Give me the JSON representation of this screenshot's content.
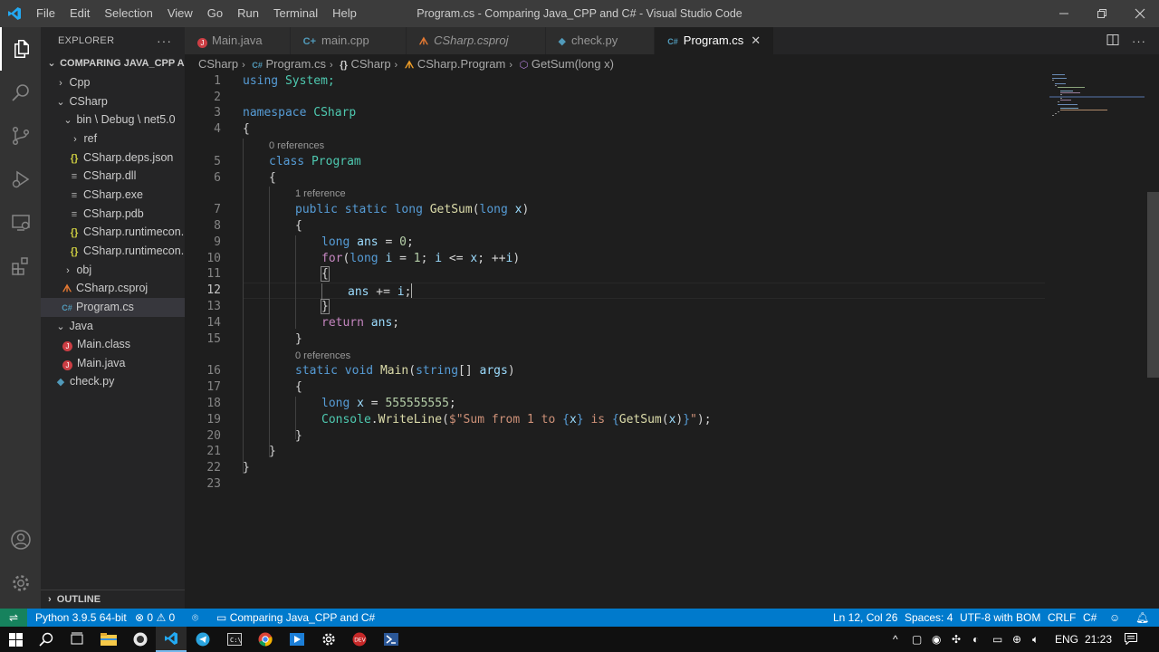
{
  "window": {
    "title": "Program.cs - Comparing Java_CPP and C# - Visual Studio Code",
    "menu": [
      "File",
      "Edit",
      "Selection",
      "View",
      "Go",
      "Run",
      "Terminal",
      "Help"
    ]
  },
  "explorer": {
    "header": "EXPLORER",
    "more": "···",
    "root": "COMPARING JAVA_CPP A...",
    "items": [
      {
        "label": "Cpp",
        "icon": "chevron-right"
      },
      {
        "label": "CSharp",
        "icon": "chevron-down"
      },
      {
        "label": "bin \\ Debug \\ net5.0",
        "icon": "chevron-down"
      },
      {
        "label": "ref",
        "icon": "chevron-right"
      },
      {
        "label": "CSharp.deps.json",
        "icon": "json-icon",
        "glyph": "{}"
      },
      {
        "label": "CSharp.dll",
        "icon": "lines-icon",
        "glyph": "≡"
      },
      {
        "label": "CSharp.exe",
        "icon": "lines-icon",
        "glyph": "≡"
      },
      {
        "label": "CSharp.pdb",
        "icon": "lines-icon",
        "glyph": "≡"
      },
      {
        "label": "CSharp.runtimecon...",
        "icon": "json-icon",
        "glyph": "{}"
      },
      {
        "label": "CSharp.runtimecon...",
        "icon": "json-icon",
        "glyph": "{}"
      },
      {
        "label": "obj",
        "icon": "chevron-right"
      },
      {
        "label": "CSharp.csproj",
        "icon": "rss-icon",
        "glyph": "ᗑ"
      },
      {
        "label": "Program.cs",
        "icon": "csharp-icon",
        "glyph": "C#"
      },
      {
        "label": "Java",
        "icon": "chevron-down"
      },
      {
        "label": "Main.class",
        "icon": "java-icon"
      },
      {
        "label": "Main.java",
        "icon": "java-icon"
      },
      {
        "label": "check.py",
        "icon": "python-icon"
      }
    ],
    "outline": "OUTLINE"
  },
  "tabs": [
    {
      "label": "Main.java",
      "icon": "java-icon"
    },
    {
      "label": "main.cpp",
      "icon": "cpp-icon",
      "glyph": "C+"
    },
    {
      "label": "CSharp.csproj",
      "icon": "rss-icon",
      "glyph": "ᗑ"
    },
    {
      "label": "check.py",
      "icon": "python-icon",
      "glyph": "◆"
    },
    {
      "label": "Program.cs",
      "icon": "csharp-icon",
      "glyph": "C#",
      "close": "✕"
    }
  ],
  "breadcrumb": {
    "parts": [
      "CSharp",
      "Program.cs",
      "CSharp",
      "CSharp.Program",
      "GetSum(long x)"
    ],
    "glyphs": [
      "C#",
      "{}",
      "ᗑ",
      "⬡"
    ]
  },
  "editor": {
    "line_numbers": [
      "1",
      "2",
      "3",
      "4",
      "5",
      "6",
      "7",
      "8",
      "9",
      "10",
      "11",
      "12",
      "13",
      "14",
      "15",
      "16",
      "17",
      "18",
      "19",
      "20",
      "21",
      "22",
      "23"
    ],
    "current_line": "12",
    "codelens": [
      "0 references",
      "1 reference",
      "0 references"
    ],
    "lines": {
      "l1": [
        "using",
        " System;"
      ],
      "l3": [
        "namespace",
        " CSharp"
      ],
      "l4": "{",
      "l5": [
        "class",
        " ",
        "Program"
      ],
      "l6": "{",
      "l7": [
        "public",
        " ",
        "static",
        " ",
        "long",
        " ",
        "GetSum",
        "(",
        "long",
        " ",
        "x",
        ")"
      ],
      "l8": "{",
      "l9": [
        "long",
        " ",
        "ans",
        " = ",
        "0",
        ";"
      ],
      "l10": [
        "for",
        "(",
        "long",
        " ",
        "i",
        " = ",
        "1",
        "; ",
        "i",
        " <= ",
        "x",
        "; ++",
        "i",
        ")"
      ],
      "l11": "{",
      "l12": [
        "ans",
        " += ",
        "i",
        ";"
      ],
      "l13": "}",
      "l14": [
        "return",
        " ",
        "ans",
        ";"
      ],
      "l15": "}",
      "l16": [
        "static",
        " ",
        "void",
        " ",
        "Main",
        "(",
        "string",
        "[] ",
        "args",
        ")"
      ],
      "l17": "{",
      "l18": [
        "long",
        " ",
        "x",
        " = ",
        "555555555",
        ";"
      ],
      "l19": [
        "Console",
        ".",
        "WriteLine",
        "(",
        "$\"Sum from 1 to ",
        "{",
        "x",
        "}",
        " is ",
        "{",
        "GetSum",
        "(",
        "x",
        ")",
        "}",
        "\"",
        ");"
      ],
      "l20": "}",
      "l21": "}",
      "l22": "}"
    }
  },
  "statusbar": {
    "remote": "⇌",
    "python": "Python 3.9.5 64-bit",
    "errors": "0",
    "warnings": "0",
    "folder": "Comparing Java_CPP and C#",
    "position": "Ln 12, Col 26",
    "spaces": "Spaces: 4",
    "encoding": "UTF-8 with BOM",
    "eol": "CRLF",
    "language": "C#"
  },
  "taskbar": {
    "lang": "ENG",
    "time": "21:23"
  },
  "colors": {
    "accent": "#007acc",
    "remote": "#16825d",
    "keyword": "#569cd6",
    "type": "#4ec9b0",
    "function": "#dcdcaa",
    "variable": "#9cdcfe",
    "number": "#b5cea8",
    "string": "#ce9178",
    "control": "#c586c0"
  }
}
